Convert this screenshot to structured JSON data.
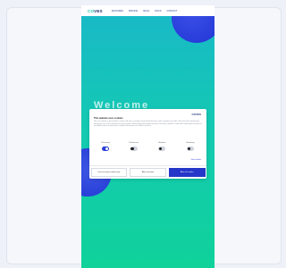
{
  "site": {
    "logo_prefix": "CO",
    "logo_suffix": "VES",
    "nav_links": [
      "FEATURES",
      "PRICING",
      "BLOG",
      "DOCS",
      "CONTACT"
    ],
    "hero_text": "Welcome"
  },
  "cookie_dialog": {
    "brand": "COVES",
    "title": "This website uses cookies",
    "body": "We use cookies to personalise content and ads, to provide social media features and to analyse our traffic. We also share information about your use of our site with our social media, advertising and analytics partners who may combine it with other information that you've provided to them or that they've collected from your use of their services.",
    "toggles": [
      {
        "label": "Necessary",
        "on": true
      },
      {
        "label": "Preferences",
        "on": false
      },
      {
        "label": "Statistics",
        "on": false
      },
      {
        "label": "Marketing",
        "on": false
      }
    ],
    "details_link": "Show details",
    "buttons": {
      "deny": "Use necessary cookies only",
      "selection": "Allow selection",
      "allow_all": "Allow all cookies"
    }
  },
  "colors": {
    "accent": "#2437c9",
    "gradient_top": "#19b8c8",
    "gradient_bottom": "#10d29a"
  }
}
